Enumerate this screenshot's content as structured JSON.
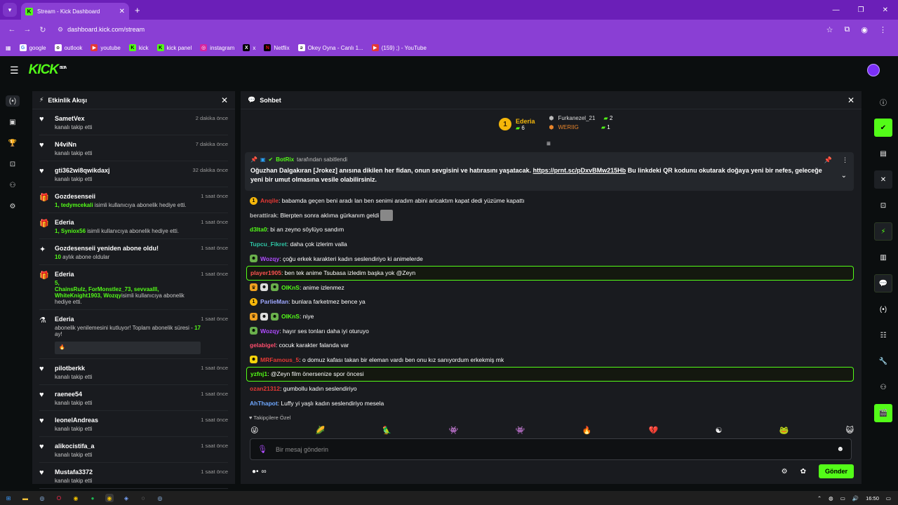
{
  "browser": {
    "tab_title": "Stream - Kick Dashboard",
    "url": "dashboard.kick.com/stream",
    "bookmarks": [
      "google",
      "outlook",
      "youtube",
      "kick",
      "kick panel",
      "instagram",
      "x",
      "Netflix",
      "Okey Oyna - Canlı 1...",
      "(159) ;) - YouTube"
    ]
  },
  "app": {
    "logo": "KICK",
    "logo_sup": "BETA"
  },
  "activity": {
    "title": "Etkinlik Akışı",
    "items": [
      {
        "icon": "heart",
        "name": "SametVex",
        "sub": "kanalı takip etti",
        "time": "2 dakika önce"
      },
      {
        "icon": "heart",
        "name": "N4viNn",
        "sub": "kanalı takip etti",
        "time": "7 dakika önce"
      },
      {
        "icon": "heart",
        "name": "gti362wi8qwikdaxj",
        "sub": "kanalı takip etti",
        "time": "32 dakika önce"
      },
      {
        "icon": "gift",
        "name": "Gozdesenseii",
        "highlight": "1, tedymcekali",
        "sub": " isimli kullanıcıya abonelik hediye etti.",
        "time": "1 saat önce"
      },
      {
        "icon": "gift",
        "name": "Ederia",
        "highlight": "1, Syniox56",
        "sub": " isimli kullanıcıya abonelik hediye etti.",
        "time": "1 saat önce"
      },
      {
        "icon": "star",
        "name": "Gozdesenseii yeniden abone oldu!",
        "highlight": "10",
        "sub": " aylık abone oldular",
        "time": "1 saat önce"
      },
      {
        "icon": "gift",
        "name": "Ederia",
        "highlight": "5,\nChainsRulz, ForMonstlez_73, sevvaalll, WhiteKnight1903, Wozqy",
        "sub": "isimli kullanıcıya abonelik hediye etti.",
        "time": "1 saat önce"
      },
      {
        "icon": "resub",
        "name": "Ederia",
        "sub": "abonelik yenilemesini kutluyor! Toplam abonelik süresi - ",
        "highlight2": "17",
        "sub2": " ay!",
        "quote": "🔥",
        "time": "1 saat önce"
      },
      {
        "icon": "heart",
        "name": "pilotberkk",
        "sub": "kanalı takip etti",
        "time": "1 saat önce"
      },
      {
        "icon": "heart",
        "name": "raenee54",
        "sub": "kanalı takip etti",
        "time": "1 saat önce"
      },
      {
        "icon": "heart",
        "name": "leonelAndreas",
        "sub": "kanalı takip etti",
        "time": "1 saat önce"
      },
      {
        "icon": "heart",
        "name": "alikocistifa_a",
        "sub": "kanalı takip etti",
        "time": "1 saat önce"
      },
      {
        "icon": "heart",
        "name": "Mustafa3372",
        "sub": "kanalı takip etti",
        "time": "1 saat önce"
      }
    ]
  },
  "chat": {
    "title": "Sohbet",
    "leaderboard": {
      "top": {
        "rank": "1",
        "name": "Ederia",
        "count": "6"
      },
      "others": [
        {
          "name": "Furkanezel_21",
          "count": "2"
        },
        {
          "name": "WERIIG",
          "count": "1"
        }
      ]
    },
    "pinned": {
      "by_user": "BotRix",
      "by_suffix": "tarafından sabitlendi",
      "text_before": "Oğuzhan Dalgakıran [Jrokez] anısına dikilen her fidan, onun sevgisini ve hatırasını yaşatacak. ",
      "link": "https://prnt.sc/pDxvBMw215Hb",
      "text_after": " Bu linkdeki QR kodunu okutarak doğaya yeni bir nefes, geleceğe yeni bir umut olmasına vesile olabilirsiniz."
    },
    "messages": [
      {
        "user": "Anqile",
        "color": "#e53935",
        "text": ": babamda geçen beni aradı lan ben senimi aradım abini aricaktım kapat dedi yüzüme kapattı",
        "badges": [
          "gold-1"
        ]
      },
      {
        "user": "berattirak",
        "color": "#bdbdbd",
        "text": ": Blerpten sonra aklıma gürkanım geldi",
        "badges": [],
        "emote": true
      },
      {
        "user": "d3lta0",
        "color": "#53fc18",
        "text": ": bi an zeyno söylüyo sandım",
        "badges": []
      },
      {
        "user": "Tupcu_Fikret",
        "color": "#2ec4a5",
        "text": ": daha çok izlerim valla",
        "badges": []
      },
      {
        "user": "Wozqy",
        "color": "#b04cff",
        "text": ": çoğu erkek karakteri kadın seslendiriyo ki animelerde",
        "badges": [
          "green"
        ]
      },
      {
        "user": "player1905",
        "color": "#ff5252",
        "text": ": ben tek anime Tsubasa izledim başka yok @Zeyn",
        "badges": [],
        "highlight": true
      },
      {
        "user": "OIKnS",
        "color": "#53fc18",
        "text": ": anime izlenmez",
        "badges": [
          "orange",
          "white",
          "green"
        ]
      },
      {
        "user": "ParlieMan",
        "color": "#9fa8ff",
        "text": ": bunlara farketmez bence ya",
        "badges": [
          "gold-1"
        ]
      },
      {
        "user": "OIKnS",
        "color": "#53fc18",
        "text": ": niye",
        "badges": [
          "orange",
          "white",
          "green"
        ]
      },
      {
        "user": "Wozqy",
        "color": "#b04cff",
        "text": ": hayır ses tonları daha iyi oturuyo",
        "badges": [
          "green"
        ]
      },
      {
        "user": "gelabigel",
        "color": "#ff4d6d",
        "text": ": cocuk karakter falanda var",
        "badges": []
      },
      {
        "user": "MRFamous_5",
        "color": "#e53935",
        "text": ": o domuz kafası takan bir eleman vardı ben onu kız sanıyordum erkekmiş mk",
        "badges": [
          "yellow"
        ]
      },
      {
        "user": "yzfnj1",
        "color": "#53fc18",
        "text": ": @Zeyn film önersenize spor öncesi",
        "badges": [],
        "highlight": true
      },
      {
        "user": "ozan21312",
        "color": "#e53935",
        "text": ": gumbollu kadın seslendiriyo",
        "badges": []
      },
      {
        "user": "AhThapot",
        "color": "#6fa8ff",
        "text": ": Luffy yi yaşlı kadın seslendiriyo mesela",
        "badges": []
      }
    ],
    "followers_only": "Takipçilere Özel",
    "composer_placeholder": "Bir mesaj gönderin",
    "send_label": "Gönder",
    "footer_counter": "∞"
  },
  "taskbar": {
    "time": "16:50"
  }
}
